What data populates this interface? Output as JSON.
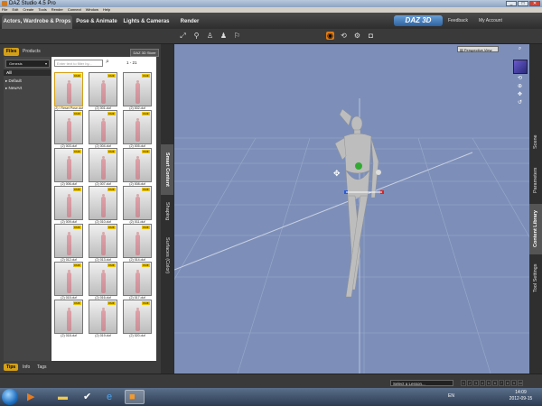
{
  "window": {
    "title": "DAZ Studio 4.5 Pro",
    "controls": [
      "_",
      "□",
      "✕"
    ]
  },
  "menubar": {
    "items": [
      "File",
      "Edit",
      "Create",
      "Tools",
      "Render",
      "Connect",
      "Window",
      "Help"
    ]
  },
  "tabs": [
    {
      "label": "Actors, Wardrobe & Props",
      "active": true
    },
    {
      "label": "Pose & Animate",
      "active": false
    },
    {
      "label": "Lights & Cameras",
      "active": false
    },
    {
      "label": "Render",
      "active": false
    }
  ],
  "header": {
    "logo": "DAZ 3D",
    "links": [
      "Feedback",
      "My Account"
    ]
  },
  "library": {
    "tabs": [
      {
        "label": "Files",
        "active": true
      },
      {
        "label": "Products",
        "active": false
      }
    ],
    "store_button": "DAZ 3D Store",
    "category_select": "Genesis",
    "categories": [
      "All",
      "Default",
      "NewArt"
    ],
    "filter_placeholder": "Enter text to filter by...",
    "count": "1 - 21",
    "items": [
      {
        "label": "(2) ! Reset Pose.duf",
        "selected": true
      },
      {
        "label": "(2) 001.duf",
        "selected": false
      },
      {
        "label": "(2) 002.duf",
        "selected": false
      },
      {
        "label": "(2) 003.duf",
        "selected": false
      },
      {
        "label": "(2) 004.duf",
        "selected": false
      },
      {
        "label": "(2) 005.duf",
        "selected": false
      },
      {
        "label": "(2) 006.duf",
        "selected": false
      },
      {
        "label": "(2) 007.duf",
        "selected": false
      },
      {
        "label": "(2) 008.duf",
        "selected": false
      },
      {
        "label": "(2) 009.duf",
        "selected": false
      },
      {
        "label": "(2) 010.duf",
        "selected": false
      },
      {
        "label": "(2) 011.duf",
        "selected": false
      },
      {
        "label": "(2) 012.duf",
        "selected": false
      },
      {
        "label": "(2) 013.duf",
        "selected": false
      },
      {
        "label": "(2) 014.duf",
        "selected": false
      },
      {
        "label": "(2) 015.duf",
        "selected": false
      },
      {
        "label": "(2) 016.duf",
        "selected": false
      },
      {
        "label": "(2) 017.duf",
        "selected": false
      },
      {
        "label": "(2) 018.duf",
        "selected": false
      },
      {
        "label": "(2) 019.duf",
        "selected": false
      },
      {
        "label": "(2) 020.duf",
        "selected": false
      }
    ],
    "badge_text": "DUF",
    "bottom_tabs": [
      {
        "label": "Tips",
        "active": true
      },
      {
        "label": "Info",
        "active": false
      },
      {
        "label": "Tags",
        "active": false
      }
    ]
  },
  "left_side_tabs": [
    {
      "label": "Smart Content",
      "active": true
    },
    {
      "label": "Shaping",
      "active": false
    },
    {
      "label": "Surfaces (Color)",
      "active": false
    }
  ],
  "right_side_tabs": [
    {
      "label": "Scene",
      "active": false
    },
    {
      "label": "Parameters",
      "active": false
    },
    {
      "label": "Content Library",
      "active": true
    },
    {
      "label": "Tool Settings",
      "active": false
    }
  ],
  "viewport": {
    "camera": "Perspective View",
    "background": "#7d8fb8"
  },
  "lesson": {
    "select": "Select a Lesson...",
    "pages": [
      "1",
      "2",
      "3",
      "4",
      "5",
      "6",
      "7",
      "8",
      "9",
      "10"
    ]
  },
  "taskbar": {
    "language": "EN",
    "time": "14:09",
    "date": "2012-09-15"
  },
  "colors": {
    "accent": "#d4a017",
    "toolbar_highlight": "#e07a10"
  }
}
